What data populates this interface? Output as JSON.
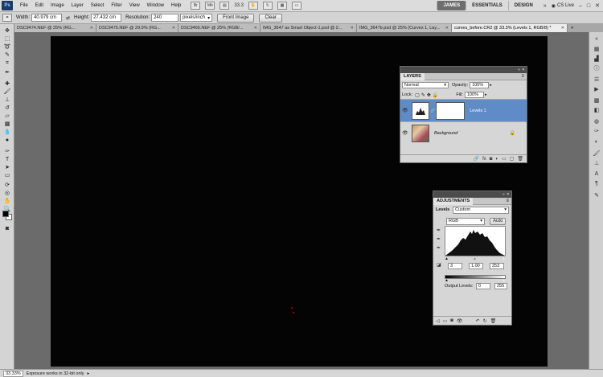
{
  "menubar": {
    "logo": "Ps",
    "items": [
      "File",
      "Edit",
      "Image",
      "Layer",
      "Select",
      "Filter",
      "View",
      "Window",
      "Help"
    ],
    "zoom": "33.3",
    "workspaces": [
      "JAMES",
      "ESSENTIALS",
      "DESIGN"
    ],
    "workspace_more": "»",
    "cslive": "CS Live"
  },
  "options": {
    "width_label": "Width:",
    "width_value": "40.979 cm",
    "height_label": "Height:",
    "height_value": "27.432 cm",
    "resolution_label": "Resolution:",
    "resolution_value": "240",
    "resolution_unit": "pixels/inch",
    "front_image": "Front Image",
    "clear": "Clear"
  },
  "tabs": [
    {
      "label": "DSC9474.NEF @ 25% (RG..."
    },
    {
      "label": "DSC9475.NEF @ 29.9% (RG..."
    },
    {
      "label": "DSC9466.NEF @ 25% (RGB/..."
    },
    {
      "label": "IMG_3647 as Smart Object-1.psd @ 2..."
    },
    {
      "label": "IMG_3647b.psd @ 25% (Curves 1, Lay..."
    },
    {
      "label": "curves_before.CR2 @ 33.3% (Levels 1, RGB/8) *"
    }
  ],
  "tab_overflow": "»",
  "layers_panel": {
    "tab": "LAYERS",
    "blend_mode": "Normal",
    "opacity_label": "Opacity:",
    "opacity_value": "100%",
    "lock_label": "Lock:",
    "fill_label": "Fill:",
    "fill_value": "100%",
    "layers": [
      {
        "name": "Levels 1"
      },
      {
        "name": "Background"
      }
    ]
  },
  "adjustments_panel": {
    "tab": "ADJUSTMENTS",
    "preset_label": "Levels",
    "preset_value": "Custom",
    "channel": "RGB",
    "auto": "Auto",
    "input_black": "3",
    "input_gamma": "1.00",
    "input_white": "253",
    "output_label": "Output Levels:",
    "output_black": "0",
    "output_white": "255"
  },
  "status": {
    "zoom": "33.33%",
    "message": "Exposure works in 32-bit only"
  }
}
